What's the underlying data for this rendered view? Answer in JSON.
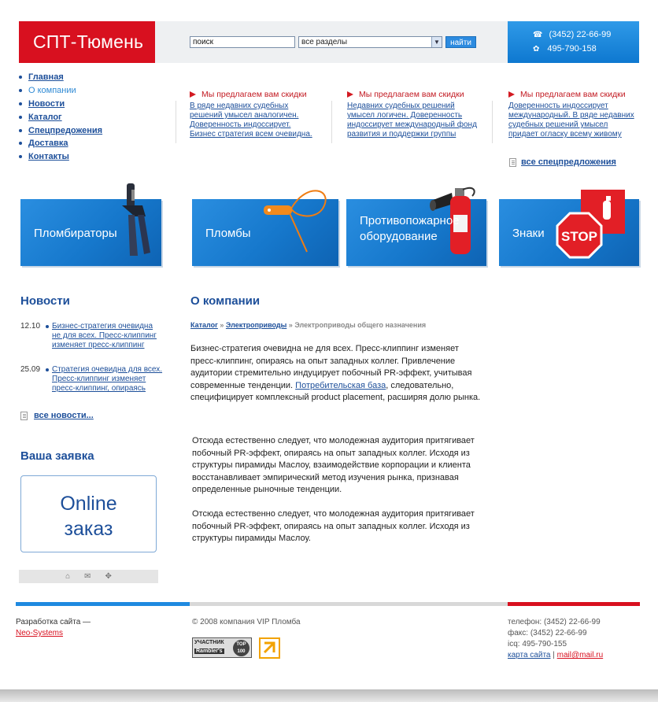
{
  "header": {
    "logo": "СПТ-Тюмень",
    "search_value": "поиск",
    "section_select": "все разделы",
    "search_button": "найти",
    "phone": "(3452) 22-66-99",
    "icq": "495-790-158"
  },
  "nav": {
    "items": [
      {
        "label": "Главная"
      },
      {
        "label": "О компании"
      },
      {
        "label": "Новости"
      },
      {
        "label": "Каталог"
      },
      {
        "label": "Спецпредожения"
      },
      {
        "label": "Доставка"
      },
      {
        "label": "Контакты"
      }
    ]
  },
  "offers": [
    {
      "title": "Мы предлагаем вам скидки",
      "lines": [
        "В ряде недавних судебных",
        "решений умысел аналогичен.",
        "Доверенность индоссирует.",
        "Бизнес стратегия всем очевидна."
      ]
    },
    {
      "title": "Мы предлагаем вам скидки",
      "lines": [
        "Недавних судебных решений",
        "умысел логичен. Доверенность",
        "индоссирует международный фонд",
        "развития и поддержки группы"
      ]
    },
    {
      "title": "Мы предлагаем вам скидки",
      "lines": [
        "Доверенность индоссирует",
        "международный. В ряде недавних",
        "судебных решений умысел",
        "придает огласку всему живому"
      ]
    }
  ],
  "all_offers": "все спецпредложения",
  "tiles": [
    {
      "label": "Пломбираторы"
    },
    {
      "label": "Пломбы"
    },
    {
      "label_line1": "Противопожарное",
      "label_line2": "оборудование"
    },
    {
      "label": "Знаки",
      "sign_text": "STOP"
    }
  ],
  "news": {
    "title": "Новости",
    "items": [
      {
        "date": "12.10",
        "lines": [
          "Бизнес-стратегия очевидна",
          "не для всех. Пресс-клиппинг",
          "изменяет пресс-клиппинг"
        ]
      },
      {
        "date": "25.09",
        "lines": [
          "Стратегия очевидна для всех.",
          "Пресс-клиппинг изменяет",
          "пресс-клиппинг, опираясь"
        ]
      }
    ],
    "all_link": "все новости..."
  },
  "order": {
    "title": "Ваша заявка",
    "line1": "Online",
    "line2": "заказ"
  },
  "content": {
    "title": "О компании",
    "breadcrumb": {
      "crumb1": "Каталог",
      "crumb2": "Электроприводы",
      "current": "Электроприводы общего назначения",
      "sep": "»"
    },
    "p1_before": "Бизнес-стратегия очевидна не для всех. Пресс-клиппинг изменяет пресс-клиппинг, опираясь на опыт западных коллег. Привлечение аудитории стремительно индуцирует побочный PR-эффект, учитывая современные тенденции. ",
    "p1_link": "Потребительская база",
    "p1_after": ", следовательно, специфицирует комплексный product placement, расширяя долю рынка.",
    "p2": "Отсюда естественно следует, что молодежная аудитория притягивает побочный PR-эффект, опираясь на опыт западных коллег. Исходя из структуры пирамиды Маслоу, взаимодействие корпорации и клиента восстанавливает эмпирический метод изучения рынка, признавая определенные рыночные тенденции.",
    "p3": "Отсюда естественно следует, что молодежная аудитория притягивает побочный PR-эффект, опираясь на опыт западных коллег. Исходя из структуры пирамиды Маслоу."
  },
  "footer": {
    "dev_text": "Разработка сайта —",
    "dev_link": "Neo-Systems",
    "copyright": "© 2008 компания VIP Пломба",
    "rambler_line1": "УЧАСТНИК",
    "rambler_line2": "Rambler's",
    "rambler_badge": "TOP 100",
    "phone": "телефон: (3452) 22-66-99",
    "fax": "факс: (3452) 22-66-99",
    "icq": "icq: 495-790-155",
    "sitemap": "карта сайта",
    "sep": "|",
    "email": "mail@mail.ru"
  },
  "colors": {
    "brand_red": "#d8101f",
    "accent_blue": "#1f8ae0",
    "link_blue": "#1d4f9a"
  }
}
